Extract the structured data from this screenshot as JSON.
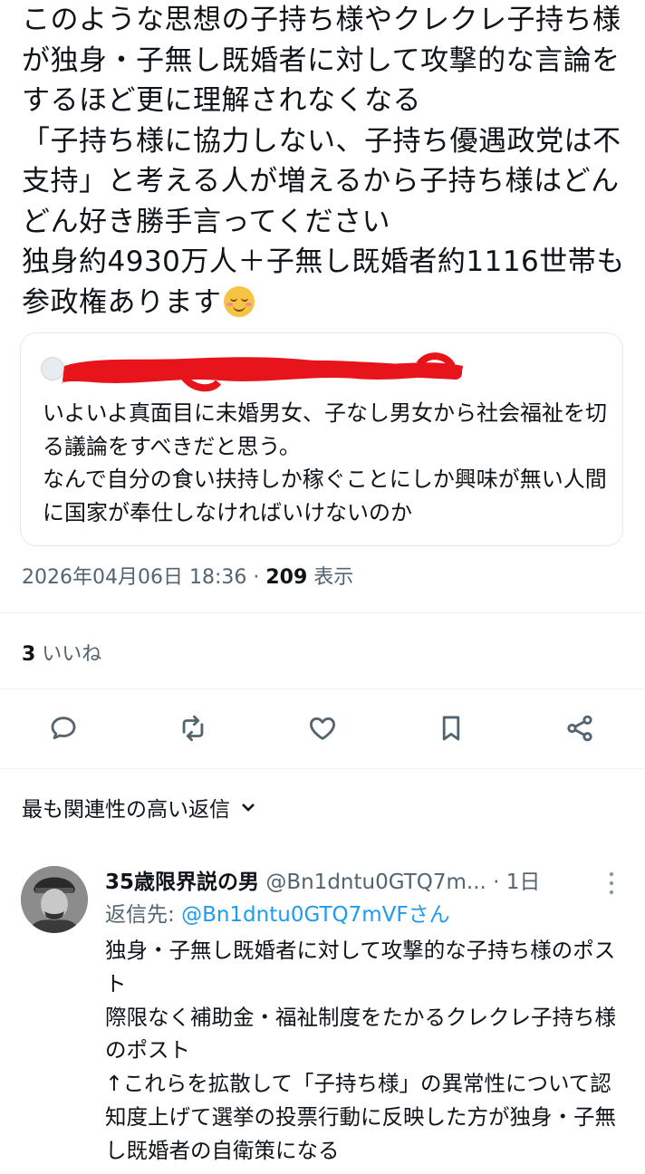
{
  "tweet": {
    "text": "このような思想の子持ち様やクレクレ子持ち様が独身・子無し既婚者に対して攻撃的な言論をするほど更に理解されなくなる\n「子持ち様に協力しない、子持ち優遇政党は不支持」と考える人が増えるから子持ち様はどんどん好き勝手言ってください\n独身約4930万人＋子無し既婚者約1116世帯も参政権あります",
    "emoji": "smiling-face-icon"
  },
  "quote": {
    "text": "いよいよ真面目に未婚男女、子なし男女から社会福祉を切る議論をすべきだと思う。\nなんで自分の食い扶持しか稼ぐことにしか興味が無い人間に国家が奉仕しなければいけないのか",
    "redaction_color": "#e8141c"
  },
  "meta": {
    "timestamp": "2026年04月06日 18:36 · ",
    "views_count": "209",
    "views_label": " 表示"
  },
  "likes": {
    "count": "3",
    "label": " いいね"
  },
  "actions": [
    "reply-icon",
    "retweet-icon",
    "like-icon",
    "bookmark-icon",
    "share-icon"
  ],
  "replies_sort": {
    "label": "最も関連性の高い返信"
  },
  "reply": {
    "name": "35歳限界説の男",
    "handle": " @Bn1dntu0GTQ7m... · 1日",
    "reply_to_label": "返信先: ",
    "reply_to_handle": "@Bn1dntu0GTQ7mVFさん",
    "text": "独身・子無し既婚者に対して攻撃的な子持ち様のポスト\n際限なく補助金・福祉制度をたかるクレクレ子持ち様のポスト\n↑これらを拡散して「子持ち様」の異常性について認知度上げて選挙の投票行動に反映した方が独身・子無し既婚者の自衛策になる"
  },
  "colors": {
    "text": "#0f1419",
    "secondary": "#536471",
    "link": "#1d9bf0",
    "border": "#e6e9ec"
  }
}
